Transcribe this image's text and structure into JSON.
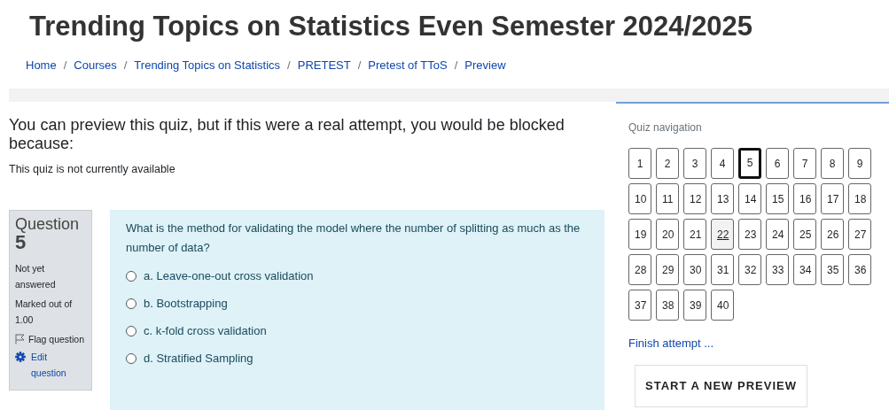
{
  "page_title": "Trending Topics on Statistics Even Semester 2024/2025",
  "breadcrumb": [
    {
      "label": "Home"
    },
    {
      "separator": "/",
      "label": "Courses"
    },
    {
      "separator": "/",
      "label": "Trending Topics on Statistics"
    },
    {
      "separator": "/",
      "label": "PRETEST"
    },
    {
      "separator": "/",
      "label": "Pretest of TToS"
    },
    {
      "separator": "/",
      "label": "Preview"
    }
  ],
  "notice": {
    "heading": "You can preview this quiz, but if this were a real attempt, you would be blocked because:",
    "reason": "This quiz is not currently available"
  },
  "question_info": {
    "label": "Question",
    "number": "5",
    "status": "Not yet answered",
    "marks": "Marked out of 1.00",
    "flag_label": "Flag question",
    "flagged": false,
    "edit_label": "Edit question"
  },
  "question": {
    "text": "What is the method for validating the model where the number of splitting as much as the number of data?",
    "options": [
      {
        "label": "a. Leave-one-out cross validation",
        "selected": false
      },
      {
        "label": "b. Bootstrapping",
        "selected": false
      },
      {
        "label": "c. k-fold cross validation",
        "selected": false
      },
      {
        "label": "d. Stratified Sampling",
        "selected": false
      }
    ]
  },
  "quiz_navigation": {
    "title": "Quiz navigation",
    "buttons": [
      {
        "label": "1",
        "selected": false,
        "focused": false
      },
      {
        "label": "2",
        "selected": false,
        "focused": false
      },
      {
        "label": "3",
        "selected": false,
        "focused": false
      },
      {
        "label": "4",
        "selected": false,
        "focused": false
      },
      {
        "label": "5",
        "selected": true,
        "focused": false
      },
      {
        "label": "6",
        "selected": false,
        "focused": false
      },
      {
        "label": "7",
        "selected": false,
        "focused": false
      },
      {
        "label": "8",
        "selected": false,
        "focused": false
      },
      {
        "label": "9",
        "selected": false,
        "focused": false
      },
      {
        "label": "10",
        "selected": false,
        "focused": false
      },
      {
        "label": "11",
        "selected": false,
        "focused": false
      },
      {
        "label": "12",
        "selected": false,
        "focused": false
      },
      {
        "label": "13",
        "selected": false,
        "focused": false
      },
      {
        "label": "14",
        "selected": false,
        "focused": false
      },
      {
        "label": "15",
        "selected": false,
        "focused": false
      },
      {
        "label": "16",
        "selected": false,
        "focused": false
      },
      {
        "label": "17",
        "selected": false,
        "focused": false
      },
      {
        "label": "18",
        "selected": false,
        "focused": false
      },
      {
        "label": "19",
        "selected": false,
        "focused": false
      },
      {
        "label": "20",
        "selected": false,
        "focused": false
      },
      {
        "label": "21",
        "selected": false,
        "focused": false
      },
      {
        "label": "22",
        "selected": false,
        "focused": true
      },
      {
        "label": "23",
        "selected": false,
        "focused": false
      },
      {
        "label": "24",
        "selected": false,
        "focused": false
      },
      {
        "label": "25",
        "selected": false,
        "focused": false
      },
      {
        "label": "26",
        "selected": false,
        "focused": false
      },
      {
        "label": "27",
        "selected": false,
        "focused": false
      },
      {
        "label": "28",
        "selected": false,
        "focused": false
      },
      {
        "label": "29",
        "selected": false,
        "focused": false
      },
      {
        "label": "30",
        "selected": false,
        "focused": false
      },
      {
        "label": "31",
        "selected": false,
        "focused": false
      },
      {
        "label": "32",
        "selected": false,
        "focused": false
      },
      {
        "label": "33",
        "selected": false,
        "focused": false
      },
      {
        "label": "34",
        "selected": false,
        "focused": false
      },
      {
        "label": "35",
        "selected": false,
        "focused": false
      },
      {
        "label": "36",
        "selected": false,
        "focused": false
      },
      {
        "label": "37",
        "selected": false,
        "focused": false
      },
      {
        "label": "38",
        "selected": false,
        "focused": false
      },
      {
        "label": "39",
        "selected": false,
        "focused": false
      },
      {
        "label": "40",
        "selected": false,
        "focused": false
      }
    ],
    "finish_link": "Finish attempt ...",
    "new_preview_button": "START A NEW PREVIEW"
  }
}
